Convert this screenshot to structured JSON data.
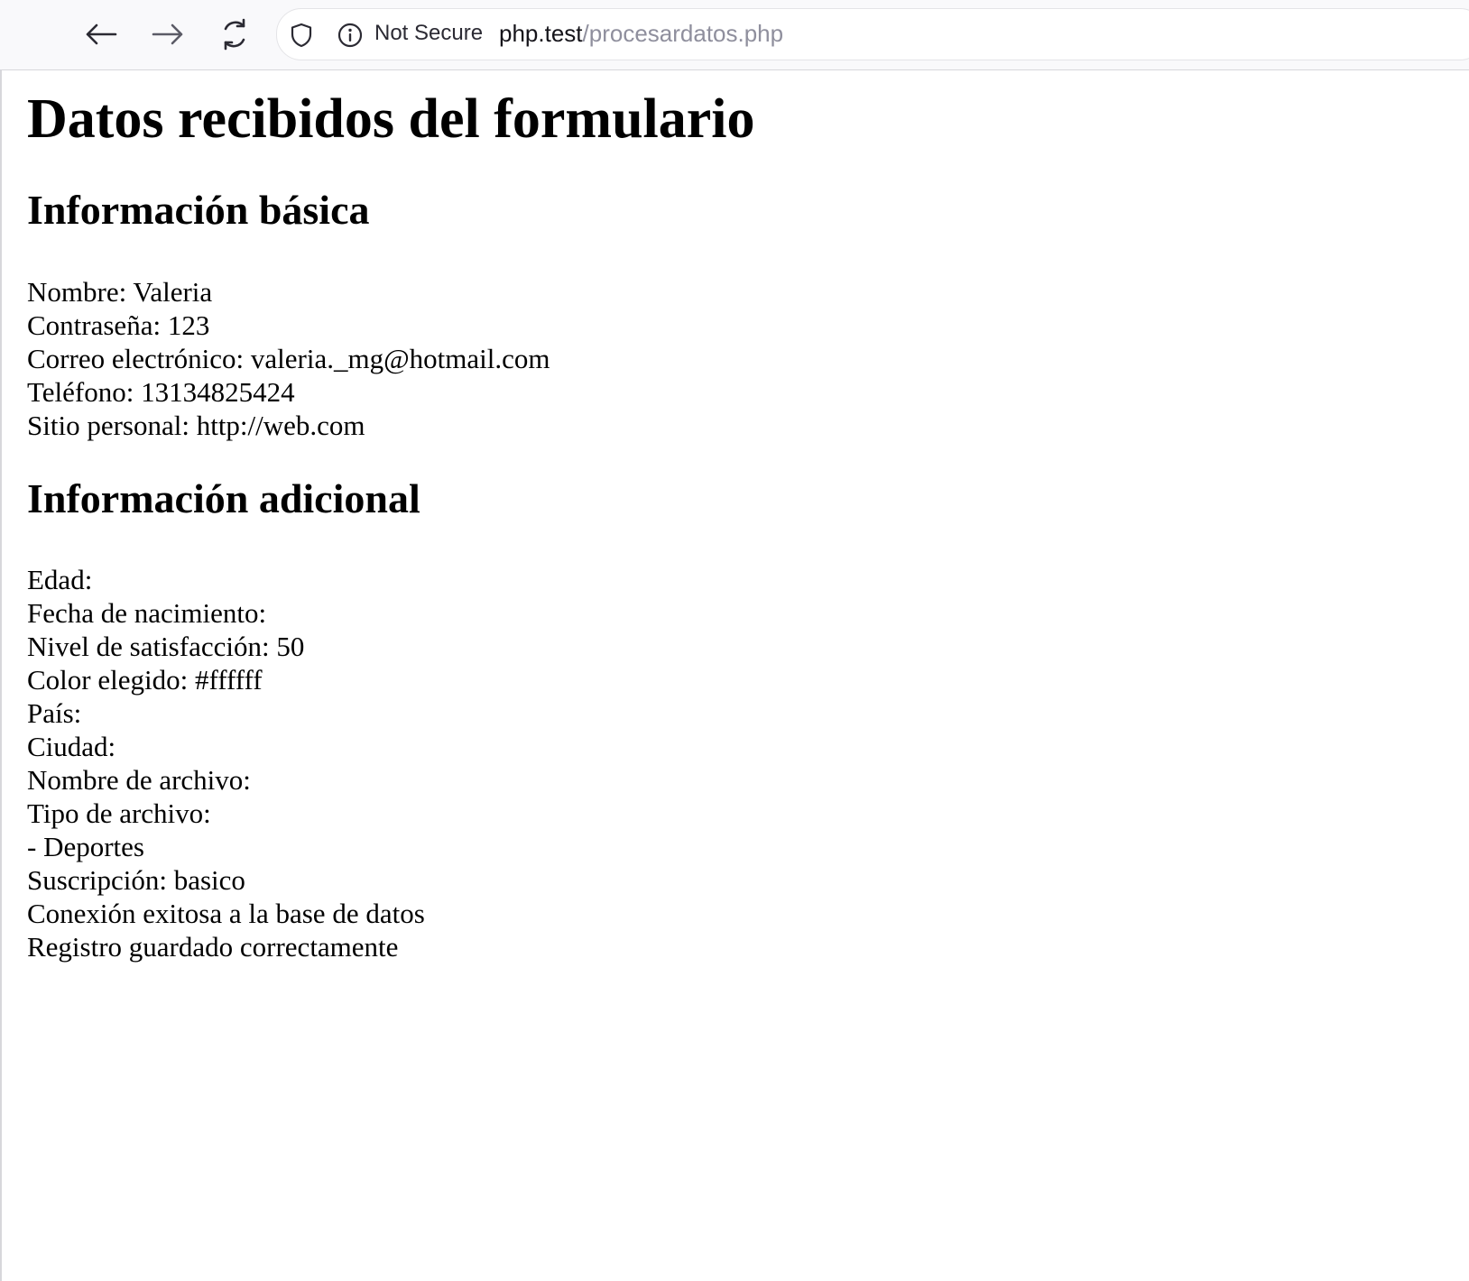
{
  "browser": {
    "security_label": "Not Secure",
    "url_host": "php.test",
    "url_path": "/procesardatos.php",
    "icons": [
      "back-arrow-icon",
      "forward-arrow-icon",
      "reload-icon",
      "shield-icon",
      "info-icon"
    ]
  },
  "page": {
    "title": "Datos recibidos del formulario",
    "basic": {
      "heading": "Información básica",
      "lines": [
        "Nombre: Valeria",
        "Contraseña: 123",
        "Correo electrónico: valeria._mg@hotmail.com",
        "Teléfono: 13134825424",
        "Sitio personal: http://web.com"
      ]
    },
    "additional": {
      "heading": "Información adicional",
      "lines": [
        "Edad:",
        "Fecha de nacimiento:",
        "Nivel de satisfacción: 50",
        "Color elegido: #ffffff",
        "País:",
        "Ciudad:",
        "Nombre de archivo:",
        "Tipo de archivo:",
        "- Deportes",
        "Suscripción: basico",
        "Conexión exitosa a la base de datos",
        "Registro guardado correctamente"
      ]
    }
  }
}
